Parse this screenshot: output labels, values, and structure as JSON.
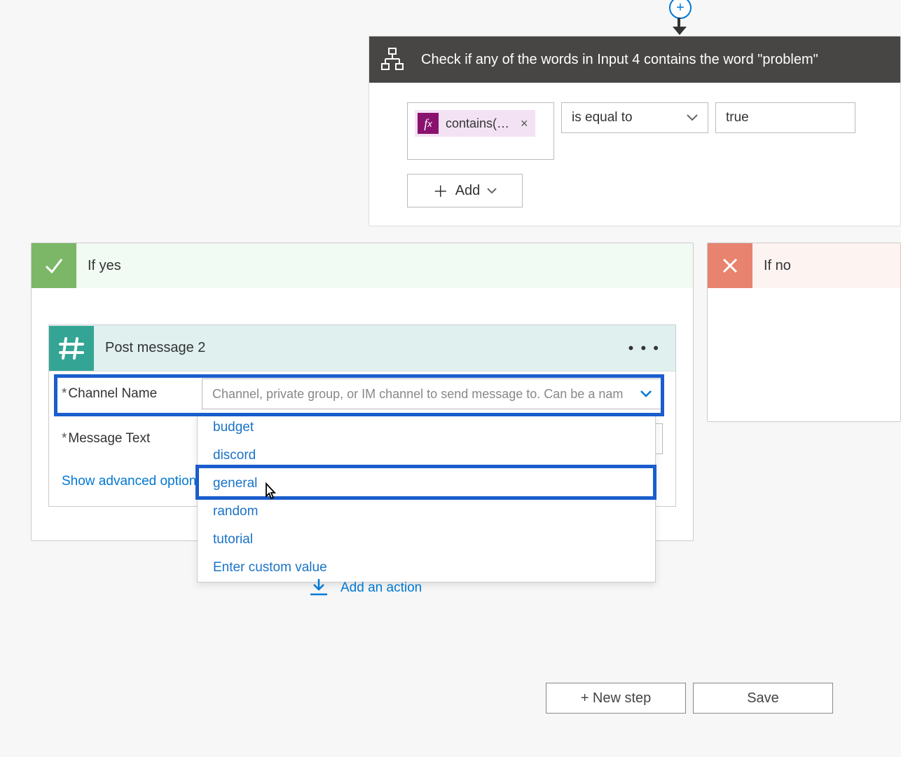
{
  "top": {
    "add_node_label": "+"
  },
  "condition": {
    "title": "Check if any of the words in Input 4 contains the word \"problem\"",
    "token_label": "contains(…",
    "operator": "is equal to",
    "value": "true",
    "add_label": "Add"
  },
  "if_yes": {
    "label": "If yes"
  },
  "if_no": {
    "label": "If no"
  },
  "action": {
    "title": "Post message 2",
    "channel_label": "Channel Name",
    "channel_placeholder": "Channel, private group, or IM channel to send message to. Can be a nam",
    "message_label": "Message Text",
    "advanced_link": "Show advanced options",
    "dropdown": {
      "options": [
        "budget",
        "discord",
        "general",
        "random",
        "tutorial"
      ],
      "custom": "Enter custom value"
    }
  },
  "add_action_label": "Add an action",
  "footer": {
    "new_step": "+ New step",
    "save": "Save"
  }
}
